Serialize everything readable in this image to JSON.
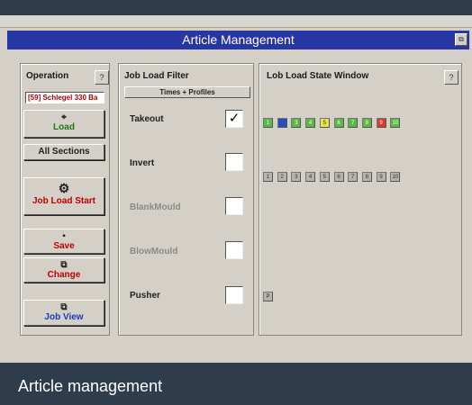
{
  "window": {
    "title": "Article Management",
    "restore_glyph": "⧉"
  },
  "operation": {
    "title": "Operation",
    "help_glyph": "?",
    "job_label": "[59] Schlegel 330 Ba",
    "load_label": "Load",
    "load_icon": "binoculars-icon",
    "all_sections_label": "All Sections",
    "job_load_start_label": "Job Load Start",
    "save_label": "Save",
    "change_label": "Change",
    "job_view_label": "Job View"
  },
  "filter": {
    "title": "Job Load Filter",
    "header": "Times + Profiles",
    "items": [
      {
        "label": "Takeout",
        "checked": "✓",
        "enabled": true
      },
      {
        "label": "Invert",
        "checked": "",
        "enabled": true
      },
      {
        "label": "BlankMould",
        "checked": "",
        "enabled": false
      },
      {
        "label": "BlowMould",
        "checked": "",
        "enabled": false
      },
      {
        "label": "Pusher",
        "checked": "",
        "enabled": true
      }
    ]
  },
  "state_window": {
    "title": "Lob Load State Window",
    "help_glyph": "?",
    "row1": [
      {
        "label": "1",
        "color": "#58b947"
      },
      {
        "label": "2",
        "color": "#2b4fb8"
      },
      {
        "label": "3",
        "color": "#58b947"
      },
      {
        "label": "4",
        "color": "#58b947"
      },
      {
        "label": "5",
        "color": "#e3e44a"
      },
      {
        "label": "6",
        "color": "#58b947"
      },
      {
        "label": "7",
        "color": "#58b947"
      },
      {
        "label": "8",
        "color": "#58b947"
      },
      {
        "label": "9",
        "color": "#d93a2a"
      },
      {
        "label": "10",
        "color": "#58b947"
      }
    ],
    "row2": [
      "1",
      "2",
      "3",
      "4",
      "5",
      "6",
      "7",
      "8",
      "9",
      "10"
    ],
    "pusher_cell": "P"
  },
  "caption": "Article management"
}
